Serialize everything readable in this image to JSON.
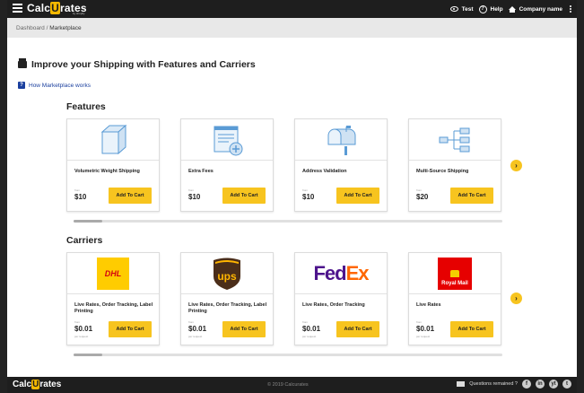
{
  "topbar": {
    "logo_pre": "Calc",
    "logo_u": "U",
    "logo_post": "rates",
    "logo_sub": "by shopify",
    "test_label": "Test",
    "help_label": "Help",
    "company_label": "Company name"
  },
  "breadcrumb": {
    "root": "Dashboard",
    "sep": " / ",
    "current": "Marketplace"
  },
  "page": {
    "title": "Improve your Shipping with Features and Carriers",
    "how_link": "How Marketplace works"
  },
  "features": {
    "title": "Features",
    "items": [
      {
        "name": "Volumetric Weight Shipping",
        "from": "from",
        "price": "$10",
        "button": "Add To Cart",
        "icon": "cube-icon"
      },
      {
        "name": "Extra Fees",
        "from": "from",
        "price": "$10",
        "button": "Add To Cart",
        "icon": "invoice-plus-icon"
      },
      {
        "name": "Address Validation",
        "from": "from",
        "price": "$10",
        "button": "Add To Cart",
        "icon": "mailbox-icon"
      },
      {
        "name": "Multi-Source Shipping",
        "from": "from",
        "price": "$20",
        "button": "Add To Cart",
        "icon": "hierarchy-icon"
      }
    ],
    "next": "›"
  },
  "carriers": {
    "title": "Carriers",
    "items": [
      {
        "name": "Live Rates, Order Tracking, Label Printing",
        "from": "from",
        "price": "$0.01",
        "per": "per request",
        "button": "Add To Cart",
        "logo": "DHL"
      },
      {
        "name": "Live Rates, Order Tracking, Label Printing",
        "from": "from",
        "price": "$0.01",
        "per": "per request",
        "button": "Add To Cart",
        "logo": "ups"
      },
      {
        "name": "Live Rates, Order Tracking",
        "from": "from",
        "price": "$0.01",
        "per": "per request",
        "button": "Add To Cart",
        "logo_fed": "Fed",
        "logo_ex": "Ex"
      },
      {
        "name": "Live Rates",
        "from": "from",
        "price": "$0.01",
        "per": "per request",
        "button": "Add To Cart",
        "logo": "Royal Mail"
      }
    ],
    "next": "›"
  },
  "footer": {
    "logo_pre": "Calc",
    "logo_u": "U",
    "logo_post": "rates",
    "copyright": "© 2019 Calcurates",
    "questions": "Questions remained ?",
    "socials": [
      "f",
      "in",
      "yt",
      "t"
    ]
  },
  "colors": {
    "accent": "#f7c41f",
    "topbar": "#1e1e1e",
    "link": "#1a3f9e",
    "dhl_bg": "#ffcc00",
    "dhl_red": "#d40511",
    "ups_brown": "#4b2e1a",
    "fedex_purple": "#4d148c",
    "fedex_orange": "#ff6600",
    "royalmail_red": "#e60000"
  }
}
